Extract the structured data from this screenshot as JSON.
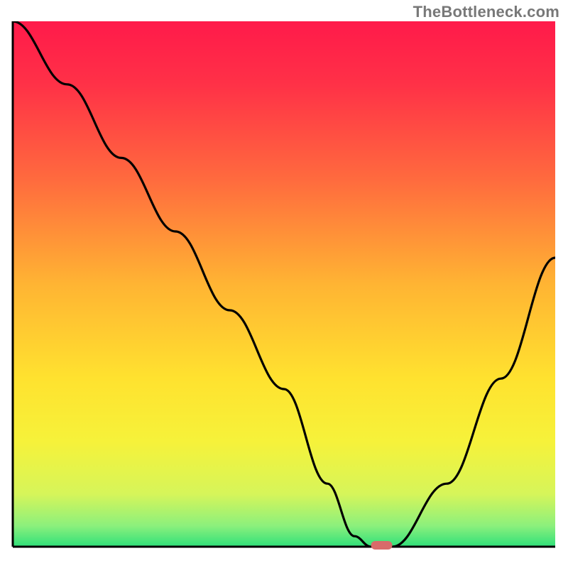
{
  "attribution": "TheBottleneck.com",
  "chart_data": {
    "type": "line",
    "title": "",
    "xlabel": "",
    "ylabel": "",
    "xlim": [
      0,
      100
    ],
    "ylim": [
      0,
      100
    ],
    "grid": false,
    "series": [
      {
        "name": "bottleneck-curve",
        "x": [
          0,
          10,
          20,
          30,
          40,
          50,
          58,
          63,
          66,
          70,
          80,
          90,
          100
        ],
        "y": [
          100,
          88,
          74,
          60,
          45,
          30,
          12,
          2,
          0,
          0,
          12,
          32,
          55
        ]
      }
    ],
    "highlight_point": {
      "x": 68,
      "y": 0,
      "color": "#d86b6a"
    },
    "gradient_stops": [
      {
        "offset": 0.0,
        "color": "#ff1a4a"
      },
      {
        "offset": 0.12,
        "color": "#ff3147"
      },
      {
        "offset": 0.3,
        "color": "#ff6a3e"
      },
      {
        "offset": 0.5,
        "color": "#ffb433"
      },
      {
        "offset": 0.68,
        "color": "#ffe22f"
      },
      {
        "offset": 0.8,
        "color": "#f6f23a"
      },
      {
        "offset": 0.9,
        "color": "#d6f55a"
      },
      {
        "offset": 0.96,
        "color": "#8cf07c"
      },
      {
        "offset": 1.0,
        "color": "#2fe07a"
      }
    ]
  }
}
